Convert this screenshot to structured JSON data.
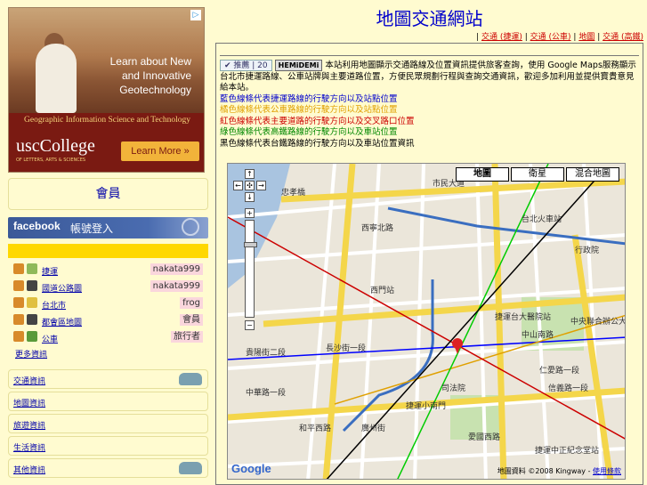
{
  "page_title": "地圖交通網站",
  "nav": {
    "links": [
      "交通 (捷運)",
      "交通 (公車)",
      "地圖",
      "交通 (高鐵)"
    ]
  },
  "ad": {
    "headline_lines": [
      "Learn about New",
      "and Innovative",
      "Geotechnology"
    ],
    "strip_text": "Geographic Information Science and Technology",
    "logo": "uscCollege",
    "logo_sub": "OF LETTERS, ARTS & SCIENCES",
    "button": "Learn More »",
    "adchoices": "▷"
  },
  "sidebar": {
    "box_title": "會員",
    "facebook_logo": "facebook",
    "facebook_text": "帳號登入",
    "recent": [
      {
        "title": "捷運",
        "user": "nakata999",
        "icon_color": "#d88a2a"
      },
      {
        "title": "國道公路圖",
        "user": "nakata999",
        "icon_color": "#444444"
      },
      {
        "title": "台北市",
        "user": "frog",
        "icon_color": "#d88a2a"
      },
      {
        "title": "都會區地圖",
        "user": "會員",
        "icon_color": "#444444"
      },
      {
        "title": "公車",
        "user": "旅行者",
        "icon_color": "#d88a2a"
      }
    ],
    "more_label": "更多資訊",
    "categories": [
      {
        "label": "交通資訊",
        "has_tank": true
      },
      {
        "label": "地圖資訊",
        "has_tank": false
      },
      {
        "label": "旅遊資訊",
        "has_tank": false
      },
      {
        "label": "生活資訊",
        "has_tank": false
      },
      {
        "label": "其他資訊",
        "has_tank": true
      }
    ]
  },
  "content": {
    "recommend_label": "✔ 推薦",
    "recommend_count": "20",
    "hemidemi_label": "HEMiDEMi",
    "intro_before": "本站利用地圖顯示交通路線及位置資訊提供旅客查詢，使用 ",
    "intro_brand": "Google Maps",
    "intro_after": "服務顯示台北市捷運路線、公車站牌與主要道路位置，方便民眾規劃行程與查詢交通資訊，歡迎多加利用並提供寶貴意見給本站。",
    "legend_lines": [
      {
        "text": "藍色線條代表捷運路線的行駛方向以及站點位置",
        "color": "#0000cc"
      },
      {
        "text": "橘色線條代表公車路線的行駛方向以及站點位置",
        "color": "#e0a000"
      },
      {
        "text": "紅色線條代表主要道路的行駛方向以及交叉路口位置",
        "color": "#cc0000"
      },
      {
        "text": "綠色線條代表高鐵路線的行駛方向以及車站位置",
        "color": "#008800"
      },
      {
        "text": "黑色線條代表台鐵路線的行駛方向以及車站位置資訊",
        "color": "#000000"
      }
    ]
  },
  "map": {
    "types": [
      "地圖",
      "衛星",
      "混合地圖"
    ],
    "active_type": "地圖",
    "google_logo": "Google",
    "copyright": "地圖資料 ©2008 Kingway -",
    "terms": "使用條款",
    "labels": [
      {
        "text": "忠孝橋",
        "color": "#333333"
      },
      {
        "text": "市民大道",
        "color": "#333333"
      },
      {
        "text": "西寧北路",
        "color": "#333333"
      },
      {
        "text": "台北火車站",
        "color": "#333333"
      },
      {
        "text": "西門站",
        "color": "#333333"
      },
      {
        "text": "中山南路",
        "color": "#333333"
      },
      {
        "text": "仁愛路一段",
        "color": "#333333"
      },
      {
        "text": "信義路一段",
        "color": "#333333"
      },
      {
        "text": "長沙街一段",
        "color": "#333333"
      },
      {
        "text": "貴陽街二段",
        "color": "#333333"
      },
      {
        "text": "和平西路",
        "color": "#333333"
      },
      {
        "text": "愛國西路",
        "color": "#333333"
      },
      {
        "text": "捷運中正紀念堂站",
        "color": "#333333"
      },
      {
        "text": "捷運小南門",
        "color": "#333333"
      },
      {
        "text": "捷運台大醫院站",
        "color": "#333333"
      },
      {
        "text": "行政院",
        "color": "#333333"
      },
      {
        "text": "司法院",
        "color": "#333333"
      },
      {
        "text": "中央聯合辦公大樓",
        "color": "#333333"
      },
      {
        "text": "廣州街",
        "color": "#333333"
      },
      {
        "text": "中華路一段",
        "color": "#333333"
      }
    ]
  }
}
